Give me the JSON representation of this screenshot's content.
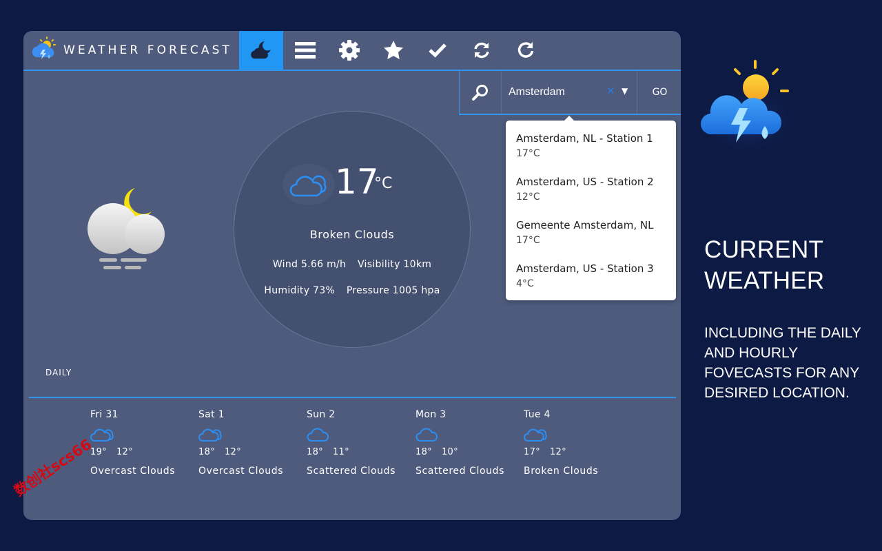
{
  "app": {
    "title": "WEATHER FORECAST"
  },
  "nav": {
    "items": [
      {
        "icon": "moon-cloud-icon",
        "active": true
      },
      {
        "icon": "menu-icon",
        "active": false
      },
      {
        "icon": "gear-icon",
        "active": false
      },
      {
        "icon": "star-icon",
        "active": false
      },
      {
        "icon": "check-icon",
        "active": false
      },
      {
        "icon": "sync-icon",
        "active": false
      },
      {
        "icon": "refresh-icon",
        "active": false
      }
    ]
  },
  "search": {
    "value": "Amsterdam",
    "clear_label": "✕",
    "dropdown_label": "▼",
    "go_label": "GO"
  },
  "suggestions": [
    {
      "name": "Amsterdam, NL - Station 1",
      "temp": "17°C"
    },
    {
      "name": "Amsterdam, US - Station 2",
      "temp": "12°C"
    },
    {
      "name": "Gemeente Amsterdam, NL",
      "temp": "17°C"
    },
    {
      "name": "Amsterdam, US - Station 3",
      "temp": "4°C"
    }
  ],
  "current": {
    "temp": "17",
    "unit": "°C",
    "description": "Broken Clouds",
    "wind": "Wind 5.66 m/h",
    "visibility": "Visibility 10km",
    "humidity": "Humidity 73%",
    "pressure": "Pressure 1005 hpa"
  },
  "daily": {
    "label": "DAILY",
    "days": [
      {
        "name": "Fri 31",
        "high": "19°",
        "low": "12°",
        "desc": "Overcast Clouds",
        "icon": "broken-clouds-icon"
      },
      {
        "name": "Sat 1",
        "high": "18°",
        "low": "12°",
        "desc": "Overcast Clouds",
        "icon": "broken-clouds-icon"
      },
      {
        "name": "Sun 2",
        "high": "18°",
        "low": "11°",
        "desc": "Scattered Clouds",
        "icon": "cloud-icon"
      },
      {
        "name": "Mon 3",
        "high": "18°",
        "low": "10°",
        "desc": "Scattered Clouds",
        "icon": "cloud-icon"
      },
      {
        "name": "Tue 4",
        "high": "17°",
        "low": "12°",
        "desc": "Broken Clouds",
        "icon": "broken-clouds-icon"
      }
    ]
  },
  "promo": {
    "title_line1": "CURRENT",
    "title_line2": "WEATHER",
    "subtitle": "INCLUDING THE DAILY AND HOURLY FOVECASTS FOR ANY DESIRED LOCATION."
  },
  "watermark": "数创社scs66",
  "colors": {
    "accent": "#2196f3",
    "panel": "#4e5b7d",
    "background": "#0d1a44"
  }
}
